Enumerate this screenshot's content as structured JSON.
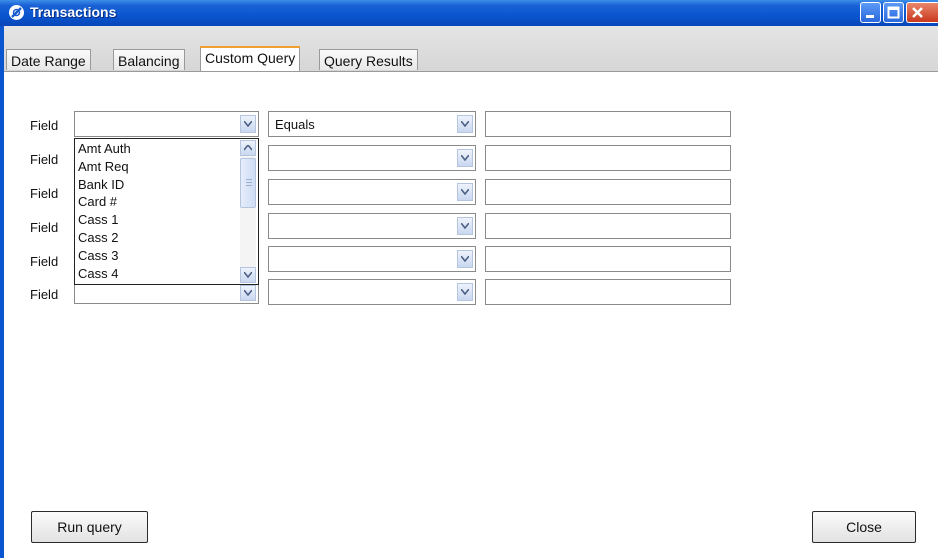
{
  "window": {
    "title": "Transactions",
    "controls": [
      "minimize-icon",
      "maximize-icon",
      "close-icon"
    ],
    "accent_color": "#0a55d0"
  },
  "tabs": [
    {
      "label": "Date Range",
      "active": false
    },
    {
      "label": "Balancing",
      "active": false
    },
    {
      "label": "Custom Query",
      "active": true
    },
    {
      "label": "Query Results",
      "active": false
    }
  ],
  "query_rows": [
    {
      "label": "Field",
      "field_value": "",
      "operator_value": "Equals",
      "value": ""
    },
    {
      "label": "Field",
      "field_value": "",
      "operator_value": "",
      "value": ""
    },
    {
      "label": "Field",
      "field_value": "",
      "operator_value": "",
      "value": ""
    },
    {
      "label": "Field",
      "field_value": "",
      "operator_value": "",
      "value": ""
    },
    {
      "label": "Field",
      "field_value": "",
      "operator_value": "",
      "value": ""
    },
    {
      "label": "Field",
      "field_value": "",
      "operator_value": "",
      "value": ""
    }
  ],
  "field_dropdown": {
    "open": true,
    "items": [
      "Amt Auth",
      "Amt Req",
      "Bank ID",
      "Card #",
      "Cass 1",
      "Cass 2",
      "Cass 3",
      "Cass 4"
    ]
  },
  "buttons": {
    "run_query": "Run query",
    "close": "Close"
  }
}
